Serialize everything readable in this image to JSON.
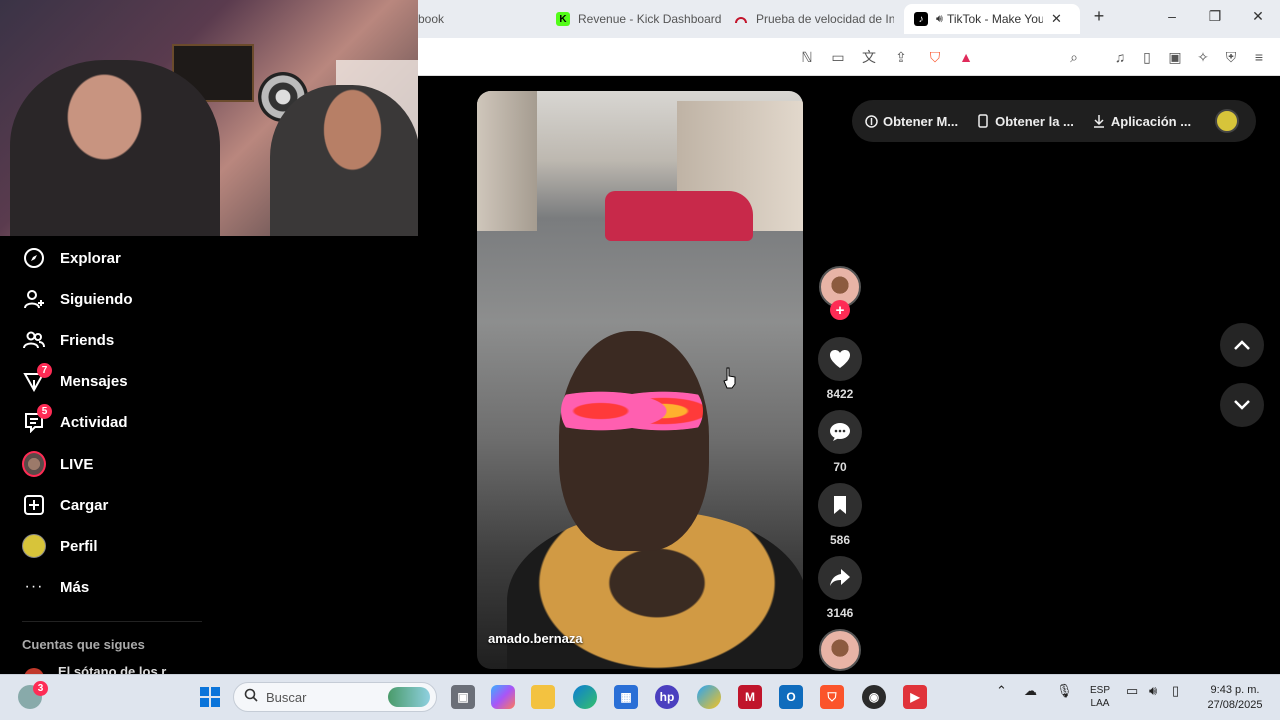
{
  "browser": {
    "tabs": [
      {
        "label": "book",
        "favicon": "facebook-icon"
      },
      {
        "label": "Revenue - Kick Dashboard",
        "favicon": "kick-icon"
      },
      {
        "label": "Prueba de velocidad de Int",
        "favicon": "speedtest-icon"
      },
      {
        "label": "TikTok - Make Your",
        "favicon": "tiktok-icon",
        "active": true
      }
    ],
    "new_tab": "+"
  },
  "sidebar": {
    "items": [
      {
        "label": "Explorar",
        "icon": "compass-icon"
      },
      {
        "label": "Siguiendo",
        "icon": "user-follow-icon"
      },
      {
        "label": "Friends",
        "icon": "friends-icon"
      },
      {
        "label": "Mensajes",
        "icon": "message-icon",
        "badge": "7"
      },
      {
        "label": "Actividad",
        "icon": "activity-icon",
        "badge": "5"
      },
      {
        "label": "LIVE",
        "icon": "live-avatar-icon"
      },
      {
        "label": "Cargar",
        "icon": "upload-icon"
      },
      {
        "label": "Perfil",
        "icon": "profile-avatar-icon"
      },
      {
        "label": "Más",
        "icon": "more-icon"
      }
    ],
    "following_title": "Cuentas que sigues",
    "following_first": "El sótano de los r"
  },
  "video": {
    "author": "amado.bernaza"
  },
  "actions": {
    "likes": "8422",
    "comments": "70",
    "saves": "586",
    "shares": "3146"
  },
  "top_pill": {
    "items": [
      "Obtener M...",
      "Obtener la ...",
      "Aplicación ..."
    ]
  },
  "taskbar": {
    "weather_badge": "3",
    "search_placeholder": "Buscar",
    "lang_line1": "ESP",
    "lang_line2": "LAA",
    "time": "9:43 p. m.",
    "date": "27/08/2025"
  },
  "colors": {
    "accent": "#fe2c55",
    "background": "#000000"
  }
}
